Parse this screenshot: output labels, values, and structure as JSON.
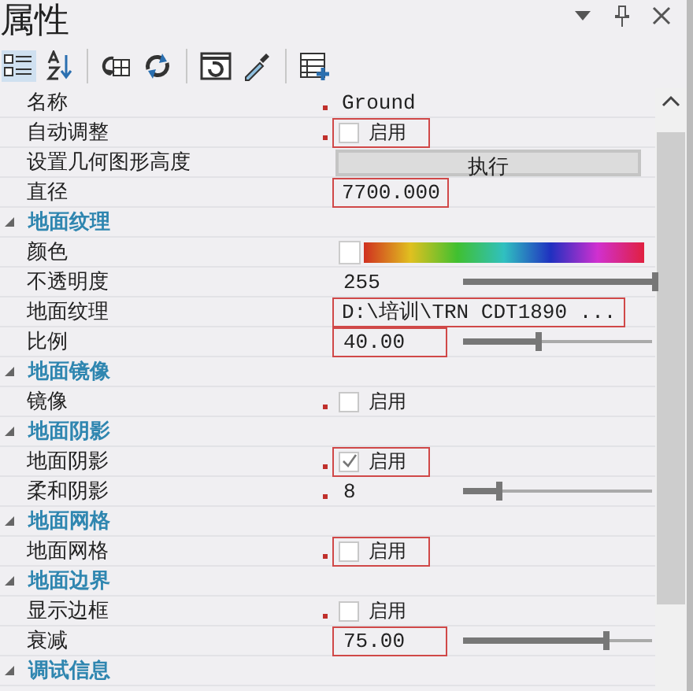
{
  "panel": {
    "title": "属性"
  },
  "rows": [
    {
      "kind": "text",
      "label": "名称",
      "value": "Ground",
      "modified": true,
      "highlighted": false
    },
    {
      "kind": "checkbox",
      "label": "自动调整",
      "value": "启用",
      "checked": false,
      "modified": true,
      "highlighted": true
    },
    {
      "kind": "button",
      "label": "设置几何图形高度",
      "value": "执行",
      "modified": false,
      "highlighted": false
    },
    {
      "kind": "text",
      "label": "直径",
      "value": "7700.000",
      "modified": false,
      "highlighted": true
    },
    {
      "kind": "category",
      "label": "地面纹理",
      "expanded": true
    },
    {
      "kind": "color",
      "label": "颜色",
      "modified": false,
      "highlighted": false
    },
    {
      "kind": "slider",
      "label": "不透明度",
      "value": "255",
      "level": 1.0,
      "modified": false,
      "highlighted": false
    },
    {
      "kind": "text",
      "label": "地面纹理",
      "value": "D:\\培训\\TRN CDT1890 ...",
      "modified": false,
      "highlighted": true
    },
    {
      "kind": "slider",
      "label": "比例",
      "value": "40.00",
      "level": 0.4,
      "modified": false,
      "highlighted": true
    },
    {
      "kind": "category",
      "label": "地面镜像",
      "expanded": true
    },
    {
      "kind": "checkbox",
      "label": "镜像",
      "value": "启用",
      "checked": false,
      "modified": true,
      "highlighted": false
    },
    {
      "kind": "category",
      "label": "地面阴影",
      "expanded": true
    },
    {
      "kind": "checkbox",
      "label": "地面阴影",
      "value": "启用",
      "checked": true,
      "modified": true,
      "highlighted": true
    },
    {
      "kind": "slider",
      "label": "柔和阴影",
      "value": "8",
      "level": 0.2,
      "modified": true,
      "highlighted": false
    },
    {
      "kind": "category",
      "label": "地面网格",
      "expanded": true
    },
    {
      "kind": "checkbox",
      "label": "地面网格",
      "value": "启用",
      "checked": false,
      "modified": true,
      "highlighted": true
    },
    {
      "kind": "category",
      "label": "地面边界",
      "expanded": true
    },
    {
      "kind": "checkbox",
      "label": "显示边框",
      "value": "启用",
      "checked": false,
      "modified": true,
      "highlighted": false
    },
    {
      "kind": "slider",
      "label": "衰减",
      "value": "75.00",
      "level": 0.75,
      "modified": false,
      "highlighted": true
    },
    {
      "kind": "category",
      "label": "调试信息",
      "expanded": true
    }
  ]
}
